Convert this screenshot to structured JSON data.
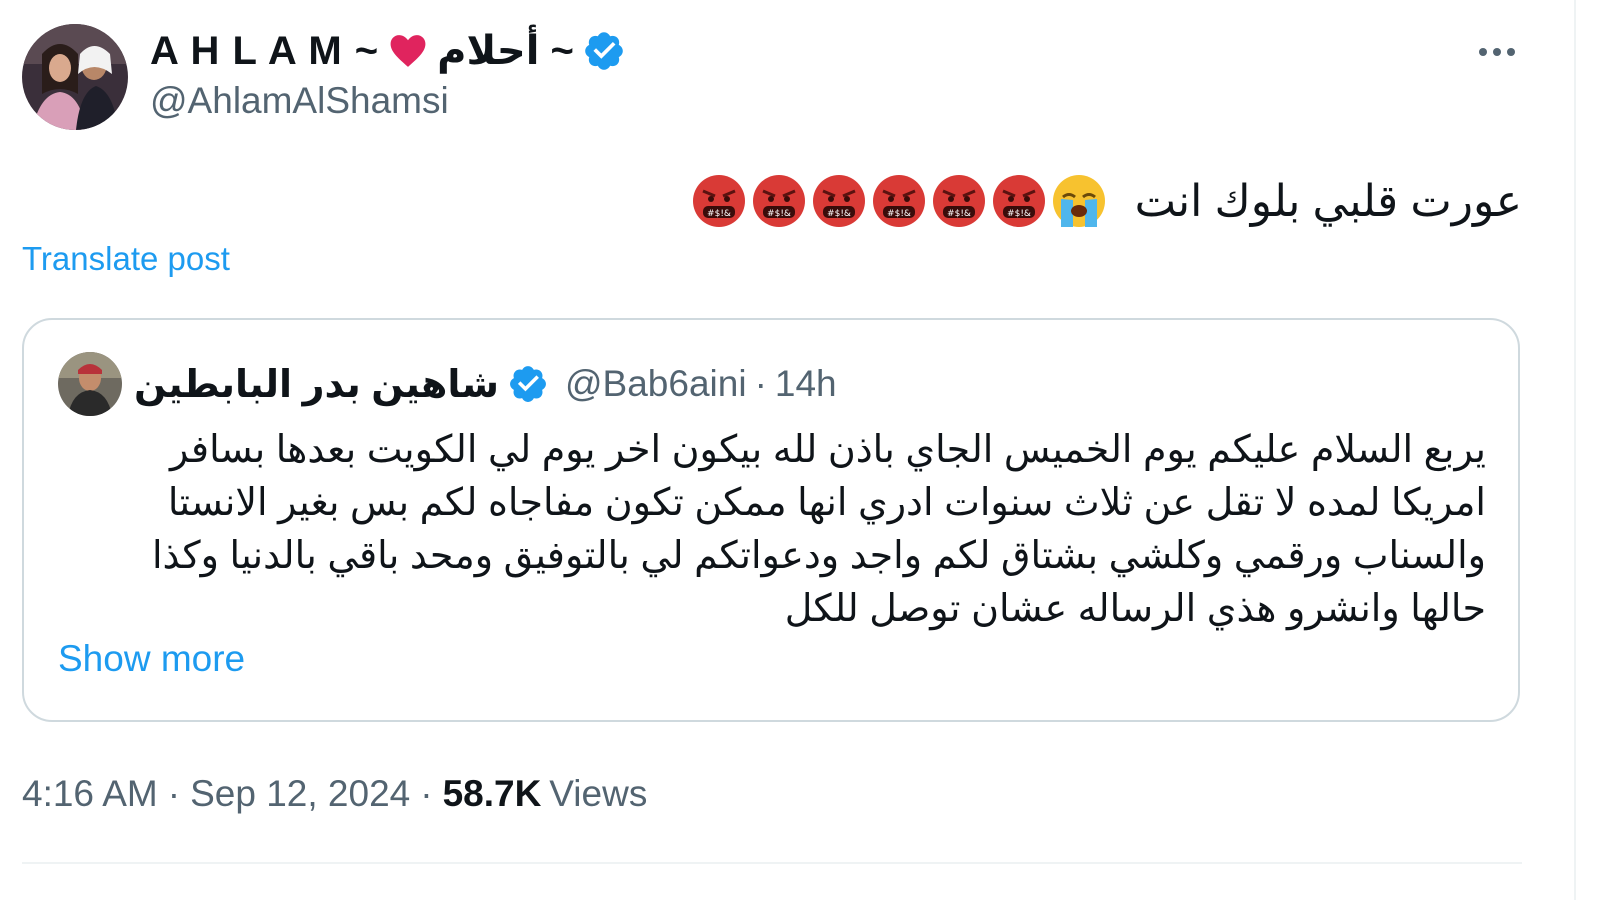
{
  "author": {
    "display_name_latin": "A H L A M ~",
    "display_name_arabic": "~ أحلام",
    "handle": "@AhlamAlShamsi",
    "verified": true,
    "heart_icon": "red-heart-icon",
    "verified_icon": "verified-badge-icon"
  },
  "more_icon": "more-horizontal-icon",
  "tweet": {
    "text": "عورت قلبي بلوك انت",
    "emojis": [
      "loudly-crying-face-emoji",
      "face-with-symbols-on-mouth-emoji",
      "face-with-symbols-on-mouth-emoji",
      "face-with-symbols-on-mouth-emoji",
      "face-with-symbols-on-mouth-emoji",
      "face-with-symbols-on-mouth-emoji",
      "face-with-symbols-on-mouth-emoji"
    ]
  },
  "translate_label": "Translate post",
  "quote": {
    "display_name": "شاهين بدر البابطين",
    "handle": "@Bab6aini",
    "separator": "·",
    "time": "14h",
    "verified": true,
    "body_lines": [
      "يربع السلام عليكم يوم الخميس الجاي باذن لله بيكون اخر يوم لي الكويت بعدها  بسافر",
      "امريكا لمده لا تقل عن ثلاث سنوات ادري انها ممكن تكون مفاجاه لكم بس بغير الانستا",
      "والسناب ورقمي وكلشي بشتاق لكم واجد ودعواتكم لي بالتوفيق ومحد باقي بالدنيا وكذا",
      "حالها وانشرو هذي الرساله عشان توصل للكل"
    ],
    "show_more_label": "Show more"
  },
  "meta": {
    "time": "4:16 AM",
    "separator": "·",
    "date": "Sep 12, 2024",
    "views_count": "58.7K",
    "views_label": "Views"
  },
  "colors": {
    "accent": "#1d9bf0",
    "text_primary": "#0f1419",
    "text_secondary": "#536471",
    "border": "#cfd9de",
    "heart": "#e0245e",
    "angry_face": "#d93a36"
  }
}
